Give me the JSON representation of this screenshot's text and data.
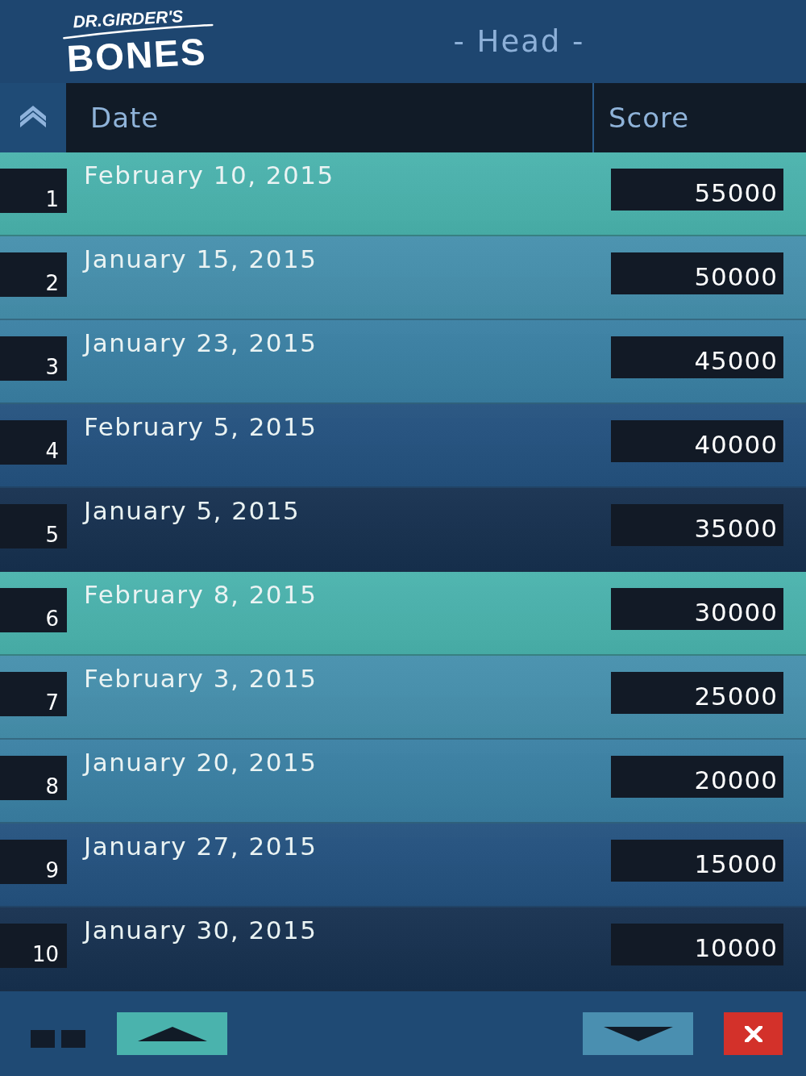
{
  "header": {
    "logo": {
      "line_1": "DR.GIRDER'S",
      "line_2": "BONES"
    },
    "title": "- Head -"
  },
  "table": {
    "columns": [
      "Date",
      "Score"
    ],
    "rows": [
      {
        "rank": "1",
        "date": "February 10, 2015",
        "score": "55000"
      },
      {
        "rank": "2",
        "date": "January 15, 2015",
        "score": "50000"
      },
      {
        "rank": "3",
        "date": "January 23, 2015",
        "score": "45000"
      },
      {
        "rank": "4",
        "date": "February 5, 2015",
        "score": "40000"
      },
      {
        "rank": "5",
        "date": "January 5, 2015",
        "score": "35000"
      },
      {
        "rank": "6",
        "date": "February 8, 2015",
        "score": "30000"
      },
      {
        "rank": "7",
        "date": "February 3, 2015",
        "score": "25000"
      },
      {
        "rank": "8",
        "date": "January 20, 2015",
        "score": "20000"
      },
      {
        "rank": "9",
        "date": "January 27, 2015",
        "score": "15000"
      },
      {
        "rank": "10",
        "date": "January 30, 2015",
        "score": "10000"
      }
    ]
  }
}
